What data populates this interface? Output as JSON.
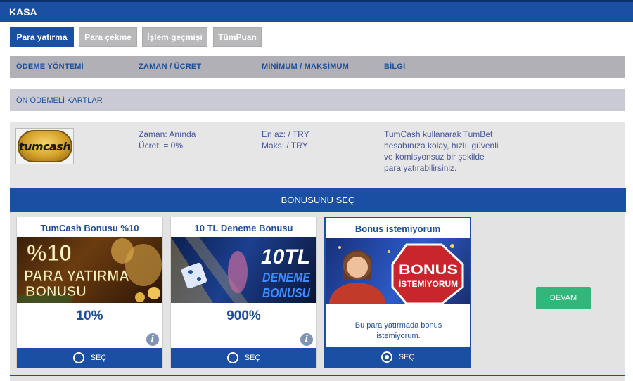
{
  "header": {
    "title": "KASA"
  },
  "tabs": [
    {
      "label": "Para yatırma",
      "active": true
    },
    {
      "label": "Para çekme",
      "active": false
    },
    {
      "label": "İşlem geçmişi",
      "active": false
    },
    {
      "label": "TümPuan",
      "active": false
    }
  ],
  "table": {
    "columns": [
      "ÖDEME YÖNTEMİ",
      "ZAMAN / ÜCRET",
      "MİNİMUM / MAKSİMUM",
      "BİLGİ"
    ],
    "section_title": "ÖN ÖDEMELİ KARTLAR",
    "row": {
      "logo_text": "tumcash",
      "time": "Zaman: Anında",
      "fee": "Ücret: = 0%",
      "min": "En az: / TRY",
      "max": "Maks: / TRY",
      "info": [
        "TumCash kullanarak TumBet",
        "hesabınıza kolay, hızlı, güvenli",
        "ve komisyonsuz bir şekilde",
        "para yatırabilirsiniz."
      ]
    }
  },
  "bonus": {
    "header": "BONUSUNU SEÇ",
    "cards": [
      {
        "title": "TumCash Bonusu %10",
        "banner": [
          "%10",
          "PARA YATIRMA",
          "BONUSU"
        ],
        "value": "10%",
        "select_label": "SEÇ",
        "selected": false
      },
      {
        "title": "10 TL Deneme Bonusu",
        "banner": [
          "10TL",
          "DENEME",
          "BONUSU"
        ],
        "value": "900%",
        "select_label": "SEÇ",
        "selected": false
      },
      {
        "title": "Bonus istemiyorum",
        "banner": [
          "BONUS",
          "İSTEMİYORUM"
        ],
        "note": "Bu para yatırmada bonus istemiyorum.",
        "select_label": "SEÇ",
        "selected": true
      }
    ],
    "continue_label": "DEVAM"
  },
  "colors": {
    "primary": "#1a4fa3",
    "continue": "#33b67a",
    "header_gray": "#b0b0b6"
  }
}
